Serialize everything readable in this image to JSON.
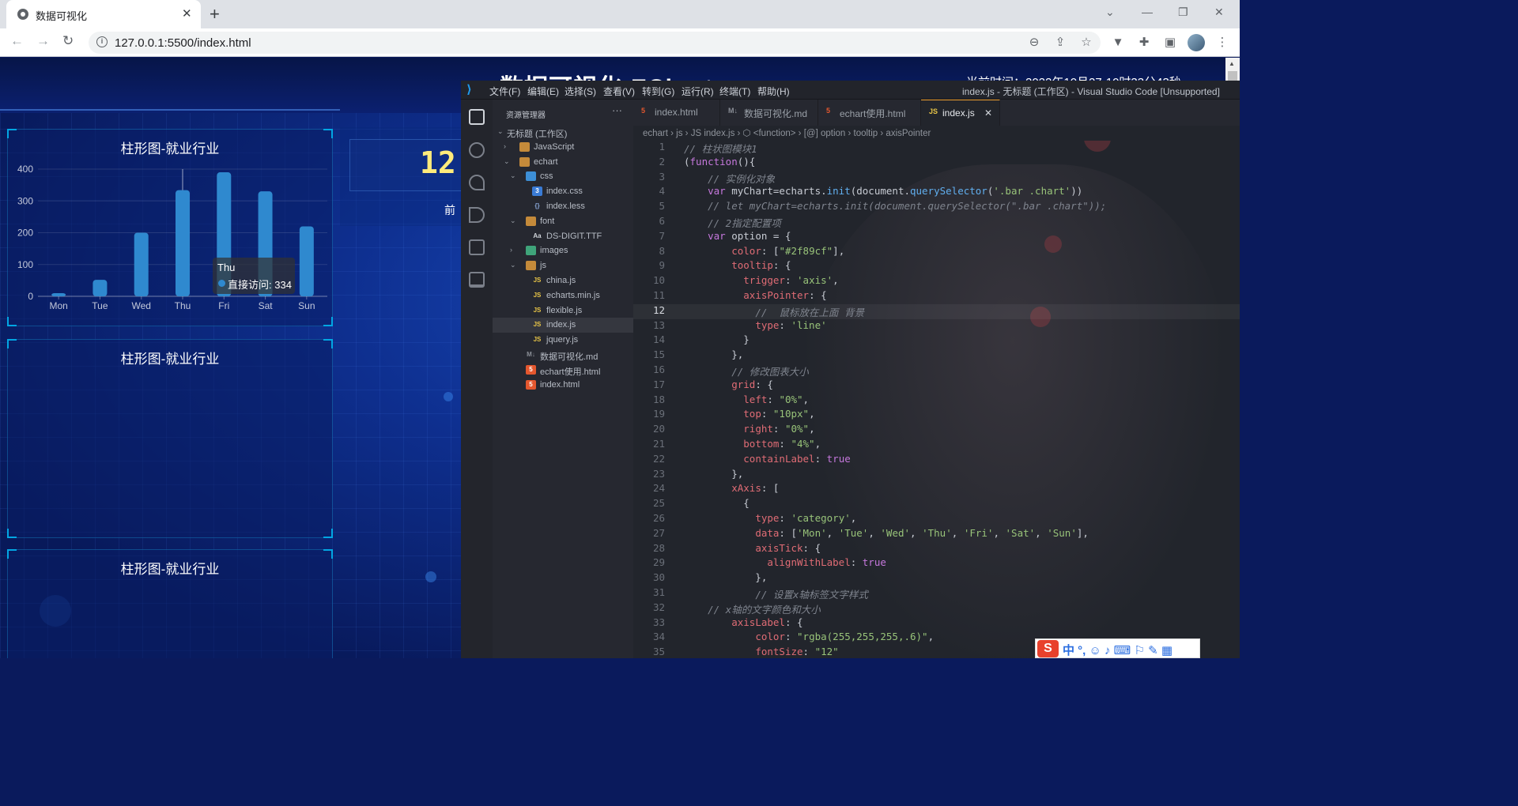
{
  "browser": {
    "tab_title": "数据可视化",
    "tab_close": "✕",
    "new_tab": "+",
    "url": "127.0.0.1:5500/index.html",
    "win_controls": [
      "⌄",
      "—",
      "❐",
      "✕"
    ]
  },
  "dashboard": {
    "title": "数据可视化-ECharts",
    "time_text": "当前时间：2022年10月27-10时33分43秒",
    "counter_value": "12",
    "counter_label": "前",
    "panels": [
      {
        "title": "柱形图-就业行业"
      },
      {
        "title": "柱形图-就业行业"
      },
      {
        "title": "柱形图-就业行业"
      }
    ],
    "tooltip": {
      "title": "Thu",
      "series": "直接访问",
      "value": 334
    }
  },
  "chart_data": {
    "type": "bar",
    "categories": [
      "Mon",
      "Tue",
      "Wed",
      "Thu",
      "Fri",
      "Sat",
      "Sun"
    ],
    "values": [
      10,
      52,
      200,
      334,
      390,
      330,
      220
    ],
    "ylim": [
      0,
      400
    ],
    "yticks": [
      0,
      100,
      200,
      300,
      400
    ],
    "color": "#2f89cf",
    "highlighted": "Thu"
  },
  "vscode": {
    "menu": [
      "文件(F)",
      "编辑(E)",
      "选择(S)",
      "查看(V)",
      "转到(G)",
      "运行(R)",
      "终端(T)",
      "帮助(H)"
    ],
    "window_title": "index.js - 无标题 (工作区) - Visual Studio Code [Unsupported]",
    "explorer_title": "资源管理器",
    "explorer_more": "···",
    "tree": [
      {
        "label": "无标题 (工作区)",
        "indent": 0,
        "twisty": "⌄",
        "icon": ""
      },
      {
        "label": "JavaScript",
        "indent": 1,
        "twisty": "›",
        "icon": "folder"
      },
      {
        "label": "echart",
        "indent": 1,
        "twisty": "⌄",
        "icon": "folder"
      },
      {
        "label": "css",
        "indent": 2,
        "twisty": "⌄",
        "icon": "folder-b"
      },
      {
        "label": "index.css",
        "indent": 3,
        "twisty": "",
        "icon": "css"
      },
      {
        "label": "index.less",
        "indent": 3,
        "twisty": "",
        "icon": "less"
      },
      {
        "label": "font",
        "indent": 2,
        "twisty": "⌄",
        "icon": "folder"
      },
      {
        "label": "DS-DIGIT.TTF",
        "indent": 3,
        "twisty": "",
        "icon": "font"
      },
      {
        "label": "images",
        "indent": 2,
        "twisty": "›",
        "icon": "folder-g"
      },
      {
        "label": "js",
        "indent": 2,
        "twisty": "⌄",
        "icon": "folder"
      },
      {
        "label": "china.js",
        "indent": 3,
        "twisty": "",
        "icon": "js"
      },
      {
        "label": "echarts.min.js",
        "indent": 3,
        "twisty": "",
        "icon": "js"
      },
      {
        "label": "flexible.js",
        "indent": 3,
        "twisty": "",
        "icon": "js"
      },
      {
        "label": "index.js",
        "indent": 3,
        "twisty": "",
        "icon": "js",
        "selected": true
      },
      {
        "label": "jquery.js",
        "indent": 3,
        "twisty": "",
        "icon": "js"
      },
      {
        "label": "数据可视化.md",
        "indent": 2,
        "twisty": "",
        "icon": "md"
      },
      {
        "label": "echart使用.html",
        "indent": 2,
        "twisty": "",
        "icon": "html"
      },
      {
        "label": "index.html",
        "indent": 2,
        "twisty": "",
        "icon": "html"
      }
    ],
    "tabs": [
      {
        "label": "index.html",
        "icon": "html",
        "active": false
      },
      {
        "label": "数据可视化.md",
        "icon": "md",
        "active": false
      },
      {
        "label": "echart使用.html",
        "icon": "html",
        "active": false
      },
      {
        "label": "index.js",
        "icon": "js",
        "active": true,
        "close": "✕"
      }
    ],
    "breadcrumbs": "echart › js › JS index.js › ⬡ <function> › [@] option › tooltip › axisPointer",
    "current_line": 12,
    "code_lines": [
      "// 柱状图模块1",
      "(function(){",
      "    // 实例化对象",
      "    var myChart=echarts.init(document.querySelector('.bar .chart'))",
      "    // let myChart=echarts.init(document.querySelector(\".bar .chart\"));",
      "    // 2指定配置项",
      "    var option = {",
      "        color: [\"#2f89cf\"],",
      "        tooltip: {",
      "          trigger: 'axis',",
      "          axisPointer: {",
      "            //  鼠标放在上面 背景",
      "            type: 'line'",
      "          }",
      "        },",
      "        // 修改图表大小",
      "        grid: {",
      "          left: \"0%\",",
      "          top: \"10px\",",
      "          right: \"0%\",",
      "          bottom: \"4%\",",
      "          containLabel: true",
      "        },",
      "        xAxis: [",
      "          {",
      "            type: 'category',",
      "            data: ['Mon', 'Tue', 'Wed', 'Thu', 'Fri', 'Sat', 'Sun'],",
      "            axisTick: {",
      "              alignWithLabel: true",
      "            },",
      "            // 设置x轴标签文字样式",
      "    // x轴的文字颜色和大小",
      "        axisLabel: {",
      "            color: \"rgba(255,255,255,.6)\",",
      "            fontSize: \"12\""
    ]
  },
  "ime": {
    "logo": "S",
    "text": "中 °, ☺ ♪ ⌨ ⚐ ✎ ▦"
  }
}
